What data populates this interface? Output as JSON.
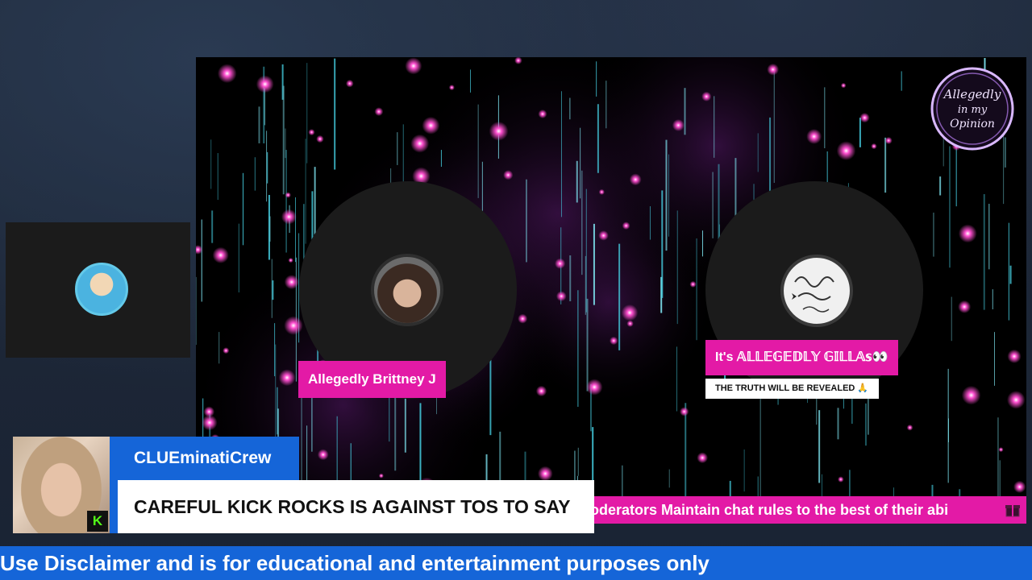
{
  "host1": {
    "name": "Allegedly Brittney J"
  },
  "host2": {
    "name": "It's 𝔸𝕃𝕃𝔼𝔾𝔼𝔻𝕃𝕐 𝔾𝕀𝕃𝕃𝔸𝕤👀",
    "subtitle": "THE TRUTH WILL BE REVEALED 🙏"
  },
  "logo": {
    "text_line1": "Allegedly",
    "text_line2": "in my",
    "text_line3": "Opinion"
  },
  "ticker": {
    "text": "oderators Maintain chat rules to the best of their abi"
  },
  "chat": {
    "username": "CLUEminatiCrew",
    "message": "CAREFUL KICK ROCKS IS AGAINST TOS TO SAY",
    "platform_badge": "K"
  },
  "bottom_ticker": {
    "text": "Use Disclaimer and is for educational and entertainment purposes only"
  },
  "colors": {
    "accent_pink": "#e31aa6",
    "accent_blue": "#1565d8",
    "kick_green": "#53fc18"
  },
  "side_guest": {
    "avatar_icon": "guest-avatar-icon"
  }
}
